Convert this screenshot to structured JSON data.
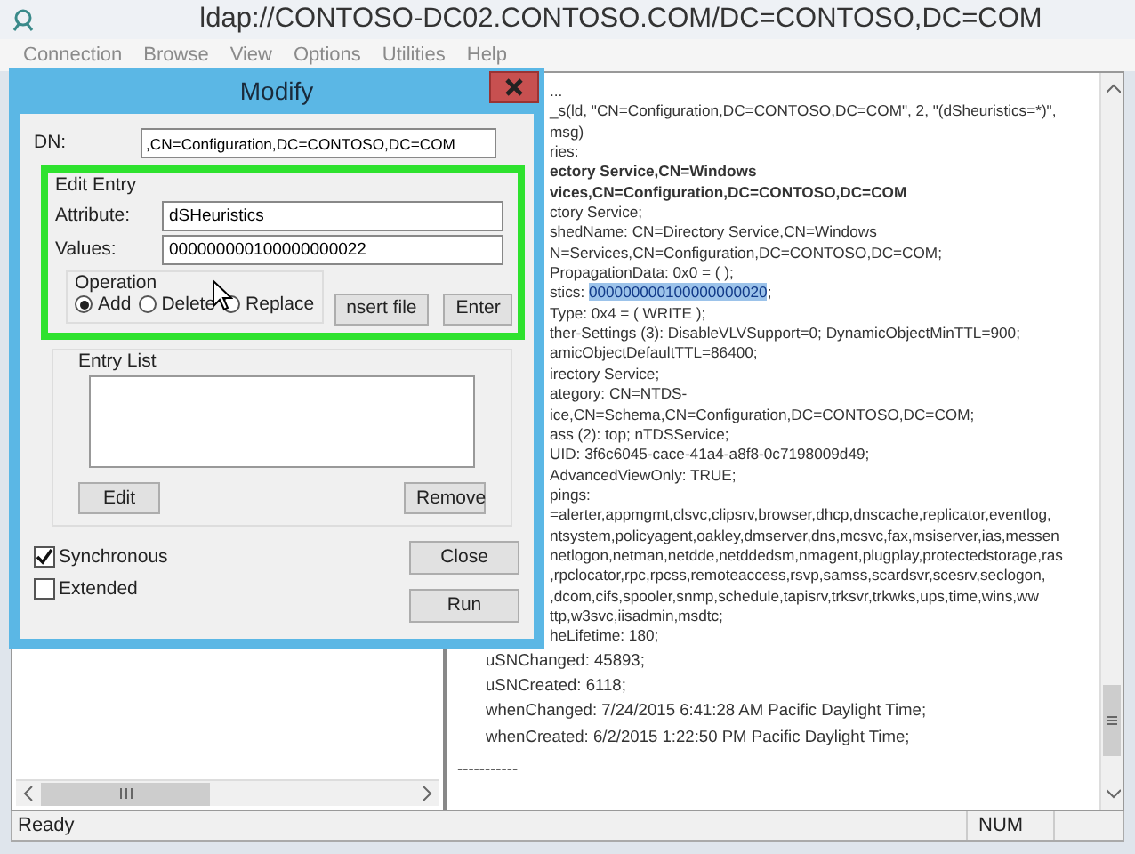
{
  "window": {
    "title": "ldap://CONTOSO-DC02.CONTOSO.COM/DC=CONTOSO,DC=COM"
  },
  "menu": [
    {
      "label": "Connection"
    },
    {
      "label": "Browse"
    },
    {
      "label": "View"
    },
    {
      "label": "Options"
    },
    {
      "label": "Utilities"
    },
    {
      "label": "Help"
    }
  ],
  "dialog": {
    "title": "Modify",
    "dn": {
      "label": "DN:",
      "value": ",CN=Configuration,DC=CONTOSO,DC=COM"
    },
    "edit_entry": {
      "label": "Edit Entry",
      "attribute": {
        "label": "Attribute:",
        "value": "dSHeuristics"
      },
      "values": {
        "label": "Values:",
        "value": "000000000100000000022"
      },
      "operation": {
        "label": "Operation",
        "options": [
          {
            "label": "Add",
            "selected": true
          },
          {
            "label": "Delete",
            "selected": false
          },
          {
            "label": "Replace",
            "selected": false
          }
        ]
      },
      "buttons": [
        "nsert file",
        "Enter"
      ]
    },
    "entry_list": {
      "label": "Entry List",
      "buttons": [
        "Edit",
        "Remove"
      ]
    },
    "options": [
      {
        "label": "Synchronous",
        "checked": true
      },
      {
        "label": "Extended",
        "checked": false
      }
    ],
    "buttons": [
      "Close",
      "Run"
    ]
  },
  "output": {
    "clipped_lines": [
      {
        "bold": false,
        "segments": [
          {
            "text": "...",
            "selected": false
          }
        ]
      },
      {
        "bold": false,
        "segments": [
          {
            "text": "_s(ld, \"CN=Configuration,DC=CONTOSO,DC=COM\", 2, \"(dSheuristics=*)\",",
            "selected": false
          }
        ]
      },
      {
        "bold": false,
        "segments": [
          {
            "text": "msg)",
            "selected": false
          }
        ]
      },
      {
        "bold": false,
        "segments": [
          {
            "text": "ries:",
            "selected": false
          }
        ]
      },
      {
        "bold": true,
        "segments": [
          {
            "text": "ectory Service,CN=Windows",
            "selected": false
          }
        ]
      },
      {
        "bold": true,
        "segments": [
          {
            "text": "vices,CN=Configuration,DC=CONTOSO,DC=COM",
            "selected": false
          }
        ]
      },
      {
        "bold": false,
        "segments": [
          {
            "text": "ctory Service;",
            "selected": false
          }
        ]
      },
      {
        "bold": false,
        "segments": [
          {
            "text": "shedName: CN=Directory Service,CN=Windows",
            "selected": false
          }
        ]
      },
      {
        "bold": false,
        "segments": [
          {
            "text": "N=Services,CN=Configuration,DC=CONTOSO,DC=COM;",
            "selected": false
          }
        ]
      },
      {
        "bold": false,
        "segments": [
          {
            "text": "PropagationData: 0x0 = (  );",
            "selected": false
          }
        ]
      },
      {
        "bold": false,
        "segments": [
          {
            "text": "stics: ",
            "selected": false
          },
          {
            "text": "000000000100000000020",
            "selected": true
          },
          {
            "text": ";",
            "selected": false
          }
        ]
      },
      {
        "bold": false,
        "segments": [
          {
            "text": "Type: 0x4 = ( WRITE );",
            "selected": false
          }
        ]
      },
      {
        "bold": false,
        "segments": [
          {
            "text": "ther-Settings (3): DisableVLVSupport=0; DynamicObjectMinTTL=900;",
            "selected": false
          }
        ]
      },
      {
        "bold": false,
        "segments": [
          {
            "text": "amicObjectDefaultTTL=86400;",
            "selected": false
          }
        ]
      },
      {
        "bold": false,
        "segments": [
          {
            "text": "irectory Service;",
            "selected": false
          }
        ]
      },
      {
        "bold": false,
        "segments": [
          {
            "text": "ategory: CN=NTDS-",
            "selected": false
          }
        ]
      },
      {
        "bold": false,
        "segments": [
          {
            "text": "ice,CN=Schema,CN=Configuration,DC=CONTOSO,DC=COM;",
            "selected": false
          }
        ]
      },
      {
        "bold": false,
        "segments": [
          {
            "text": "ass (2): top; nTDSService;",
            "selected": false
          }
        ]
      },
      {
        "bold": false,
        "segments": [
          {
            "text": "UID: 3f6c6045-cace-41a4-a8f8-0c7198009d49;",
            "selected": false
          }
        ]
      },
      {
        "bold": false,
        "segments": [
          {
            "text": "AdvancedViewOnly: TRUE;",
            "selected": false
          }
        ]
      },
      {
        "bold": false,
        "segments": [
          {
            "text": "pings:",
            "selected": false
          }
        ]
      },
      {
        "bold": false,
        "segments": [
          {
            "text": "=alerter,appmgmt,clsvc,clipsrv,browser,dhcp,dnscache,replicator,eventlog,",
            "selected": false
          }
        ]
      },
      {
        "bold": false,
        "segments": [
          {
            "text": "ntsystem,policyagent,oakley,dmserver,dns,mcsvc,fax,msiserver,ias,messen",
            "selected": false
          }
        ]
      },
      {
        "bold": false,
        "segments": [
          {
            "text": "netlogon,netman,netdde,netddedsm,nmagent,plugplay,protectedstorage,ras",
            "selected": false
          }
        ]
      },
      {
        "bold": false,
        "segments": [
          {
            "text": ",rpclocator,rpc,rpcss,remoteaccess,rsvp,samss,scardsvr,scesrv,seclogon,",
            "selected": false
          }
        ]
      },
      {
        "bold": false,
        "segments": [
          {
            "text": ",dcom,cifs,spooler,snmp,schedule,tapisrv,trksvr,trkwks,ups,time,wins,ww",
            "selected": false
          }
        ]
      },
      {
        "bold": false,
        "segments": [
          {
            "text": "ttp,w3svc,iisadmin,msdtc;",
            "selected": false
          }
        ]
      },
      {
        "bold": false,
        "segments": [
          {
            "text": "heLifetime: 180;",
            "selected": false
          }
        ]
      }
    ],
    "lines": [
      "uSNChanged: 45893;",
      "uSNCreated: 6118;",
      "whenChanged: 7/24/2015 6:41:28 AM Pacific Daylight Time;",
      "whenCreated: 6/2/2015 1:22:50 PM Pacific Daylight Time;"
    ],
    "separator": "-----------"
  },
  "status_bar": {
    "text": "Ready",
    "indicator": "NUM"
  }
}
